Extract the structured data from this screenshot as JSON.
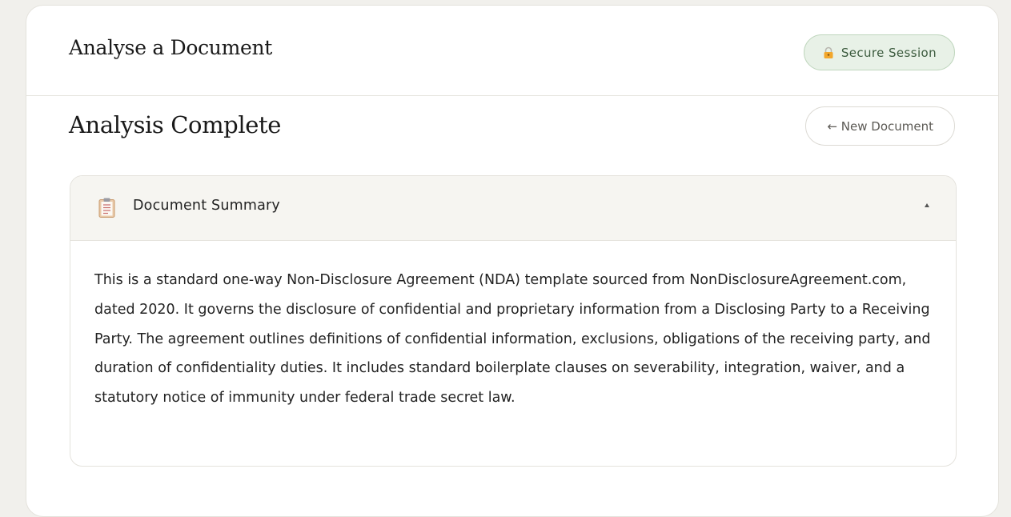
{
  "header": {
    "title": "Analyse a Document",
    "badge_icon": "lock-icon",
    "badge_label": "Secure Session"
  },
  "section": {
    "title": "Analysis Complete",
    "new_document_label": "← New Document"
  },
  "summary": {
    "icon": "clipboard-icon",
    "title": "Document Summary",
    "toggle_icon": "collapse-triangle-icon",
    "expanded": true,
    "text": "This is a standard one-way Non-Disclosure Agreement (NDA) template sourced from NonDisclosureAgreement.com, dated 2020. It governs the disclosure of confidential and proprietary information from a Disclosing Party to a Receiving Party. The agreement outlines definitions of confidential information, exclusions, obligations of the receiving party, and duration of confidentiality duties. It includes standard boilerplate clauses on severability, integration, waiver, and a statutory notice of immunity under federal trade secret law."
  },
  "colors": {
    "page_background": "#f1f0ec",
    "badge_background": "#e8f1e7",
    "badge_text": "#3b5a3d",
    "panel_header_background": "#f6f5f1"
  }
}
